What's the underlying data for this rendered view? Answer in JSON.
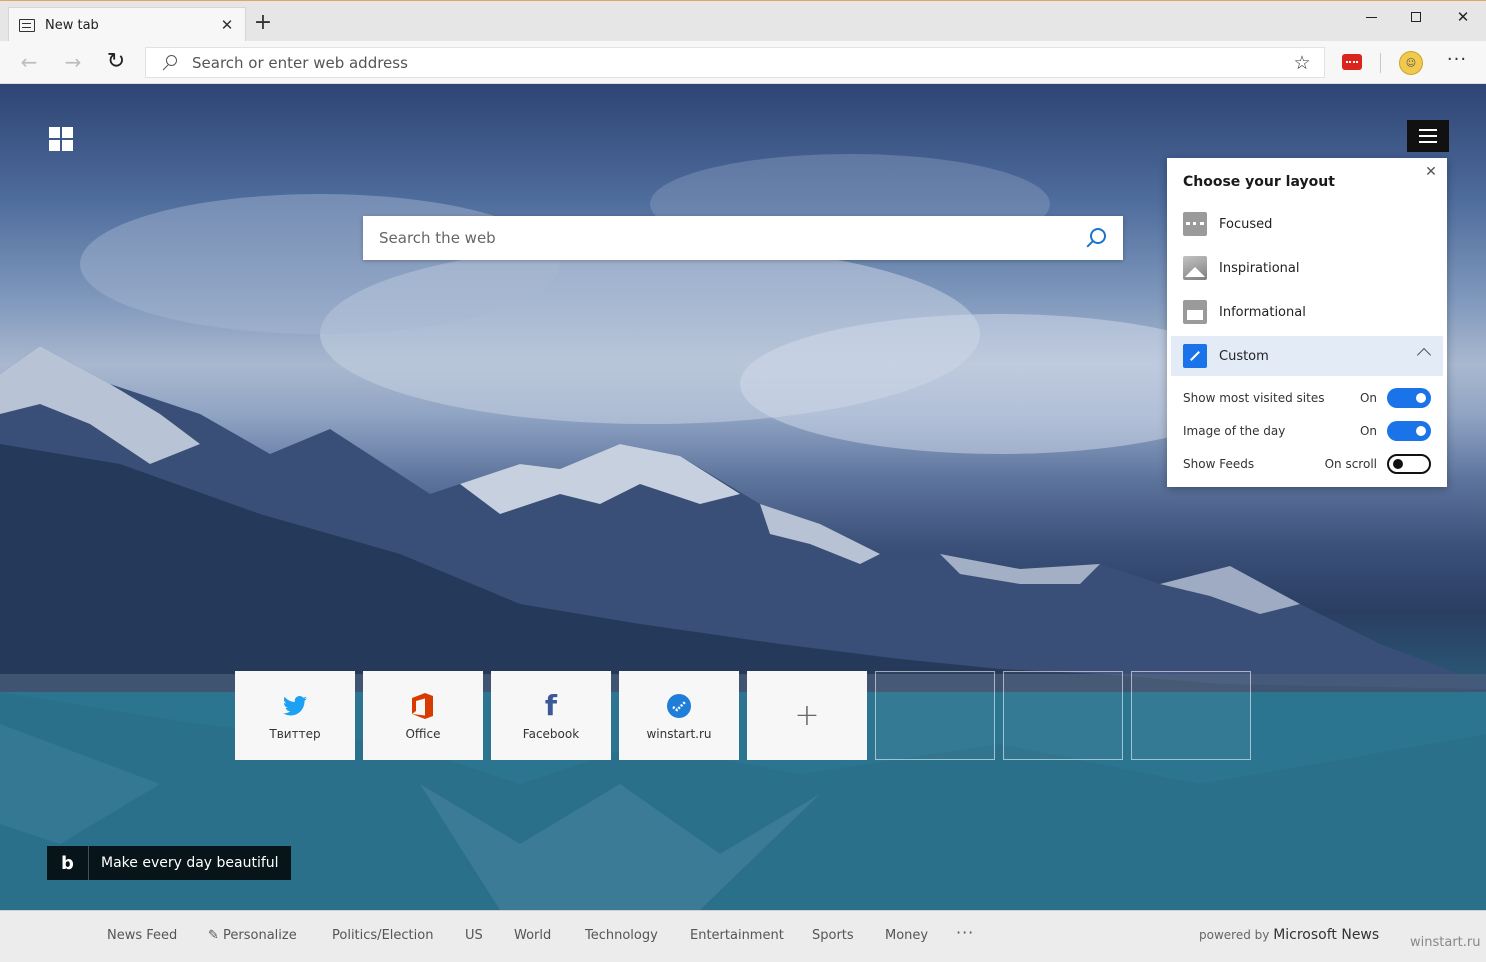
{
  "browser": {
    "tab_title": "New tab",
    "tab_close": "✕",
    "new_tab": "+",
    "window_close": "✕",
    "address_placeholder": "Search or enter web address",
    "favorite_icon": "star-icon",
    "more": "···"
  },
  "page": {
    "search_placeholder": "Search the web",
    "bing_badge_text": "Make every day beautiful",
    "bing_logo": "b"
  },
  "layout_panel": {
    "title": "Choose your layout",
    "close": "✕",
    "options": [
      {
        "label": "Focused",
        "icon": "focused-layout-icon"
      },
      {
        "label": "Inspirational",
        "icon": "inspirational-layout-icon"
      },
      {
        "label": "Informational",
        "icon": "informational-layout-icon"
      },
      {
        "label": "Custom",
        "icon": "custom-layout-icon",
        "selected": true
      }
    ],
    "settings": [
      {
        "label": "Show most visited sites",
        "state": "On",
        "enabled": true
      },
      {
        "label": "Image of the day",
        "state": "On",
        "enabled": true
      },
      {
        "label": "Show Feeds",
        "state": "On scroll",
        "enabled": false
      }
    ]
  },
  "quick_links": [
    {
      "label": "Твиттер",
      "icon": "twitter-icon",
      "color": "#1da1f2"
    },
    {
      "label": "Office",
      "icon": "office-icon",
      "color": "#d83b01"
    },
    {
      "label": "Facebook",
      "icon": "facebook-icon",
      "color": "#3b5998"
    },
    {
      "label": "winstart.ru",
      "icon": "winstart-icon",
      "color": "#1e7ed8"
    }
  ],
  "add_link": "+",
  "news_bar": {
    "items": [
      "News Feed",
      "Personalize",
      "Politics/Election",
      "US",
      "World",
      "Technology",
      "Entertainment",
      "Sports",
      "Money"
    ],
    "more": "···",
    "powered_by": "powered by",
    "brand": "Microsoft News",
    "watermark": "winstart.ru"
  },
  "colors": {
    "accent": "#1a73e8",
    "panel_selected": "#e3ebf6"
  }
}
